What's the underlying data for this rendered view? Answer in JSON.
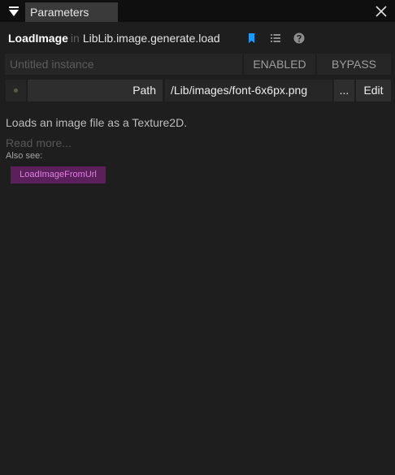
{
  "window": {
    "tab_label": "Parameters",
    "icons": {
      "menu": "triangle-down-icon",
      "close": "close-icon"
    }
  },
  "operator": {
    "name": "LoadImage",
    "in_word": "in",
    "namespace": "LibLib.image.generate.load",
    "icons": [
      "bookmark-icon",
      "list-icon",
      "help-icon"
    ],
    "bookmark_color": "#1a9bff"
  },
  "instance": {
    "placeholder": "Untitled instance",
    "enabled_label": "ENABLED",
    "bypass_label": "BYPASS"
  },
  "parameters": [
    {
      "label": "Path",
      "value": "/Lib/images/font-6x6px.png",
      "browse_label": "...",
      "edit_label": "Edit"
    }
  ],
  "documentation": {
    "description": "Loads an image file as a Texture2D.",
    "read_more": "Read more...",
    "also_see_label": "Also see:",
    "related": [
      "LoadImageFromUrl"
    ],
    "related_color": "#5b1f5b"
  }
}
